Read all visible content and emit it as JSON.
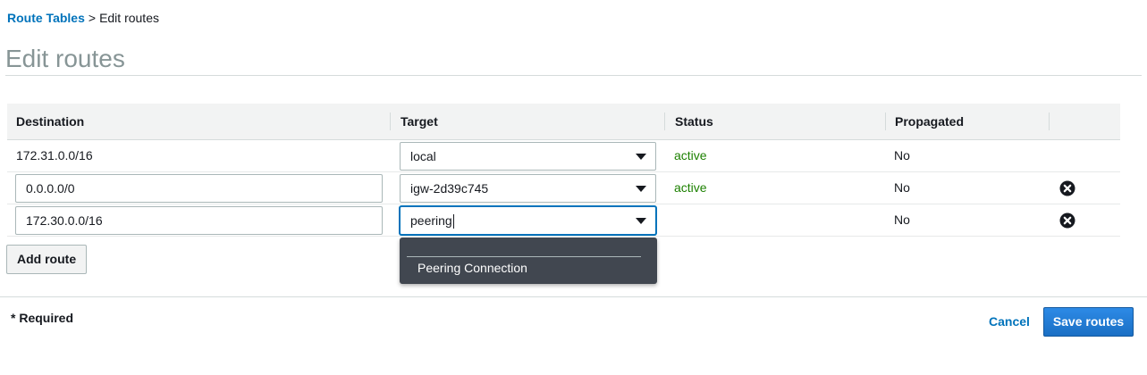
{
  "breadcrumb": {
    "parent": "Route Tables",
    "separator": ">",
    "current": "Edit routes"
  },
  "page": {
    "title": "Edit routes"
  },
  "table": {
    "columns": [
      "Destination",
      "Target",
      "Status",
      "Propagated"
    ],
    "rows": [
      {
        "destination": "172.31.0.0/16",
        "destination_editable": false,
        "target": "local",
        "status": "active",
        "propagated": "No",
        "removable": false
      },
      {
        "destination": "0.0.0.0/0",
        "destination_editable": true,
        "target": "igw-2d39c745",
        "status": "active",
        "propagated": "No",
        "removable": true
      },
      {
        "destination": "172.30.0.0/16",
        "destination_editable": true,
        "target": "peering",
        "status": "",
        "propagated": "No",
        "removable": true
      }
    ]
  },
  "dropdown": {
    "items": [
      "Peering Connection"
    ]
  },
  "actions": {
    "add_route": "Add route",
    "cancel": "Cancel",
    "save": "Save routes"
  },
  "footer": {
    "required_note": "* Required"
  },
  "colors": {
    "link": "#0073bb",
    "status_active": "#1d8102",
    "primary_button": "#1f7fdf",
    "dropdown_bg": "#414750",
    "header_bg": "#f2f3f3"
  },
  "icons": {
    "remove": "close-circle-icon",
    "select_caret": "caret-down-icon"
  }
}
